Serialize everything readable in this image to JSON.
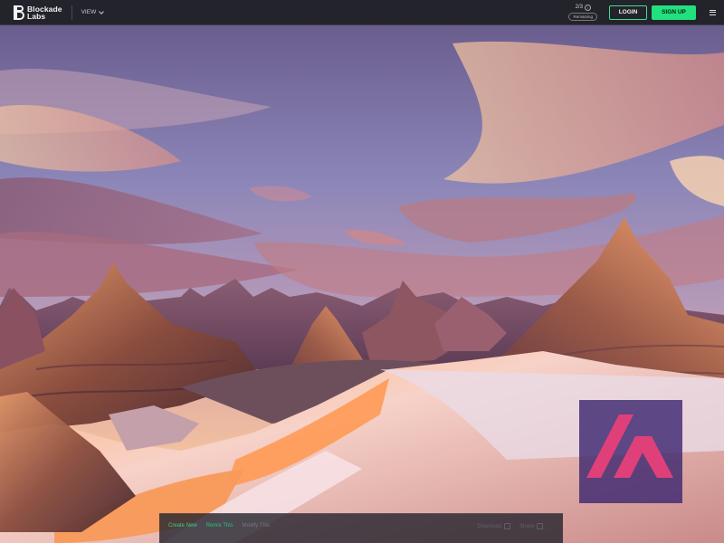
{
  "header": {
    "brand_line1": "Blockade",
    "brand_line2": "Labs",
    "view_label": "VIEW",
    "credits_count": "2/3",
    "credits_pill": "Remaining",
    "login_label": "LOGIN",
    "signup_label": "SIGN UP"
  },
  "bottom_bar": {
    "tabs": [
      {
        "label": "Create New"
      },
      {
        "label": "Remix This"
      },
      {
        "label": "Modify This"
      }
    ],
    "tool_1": "Download",
    "tool_2": "Share"
  },
  "colors": {
    "accent": "#21e07e",
    "header_bg": "#23232b"
  },
  "icons": [
    "blockade-logo-icon",
    "chevron-down-icon",
    "info-icon",
    "menu-icon",
    "download-icon",
    "share-icon",
    "watermark-logo-icon"
  ]
}
